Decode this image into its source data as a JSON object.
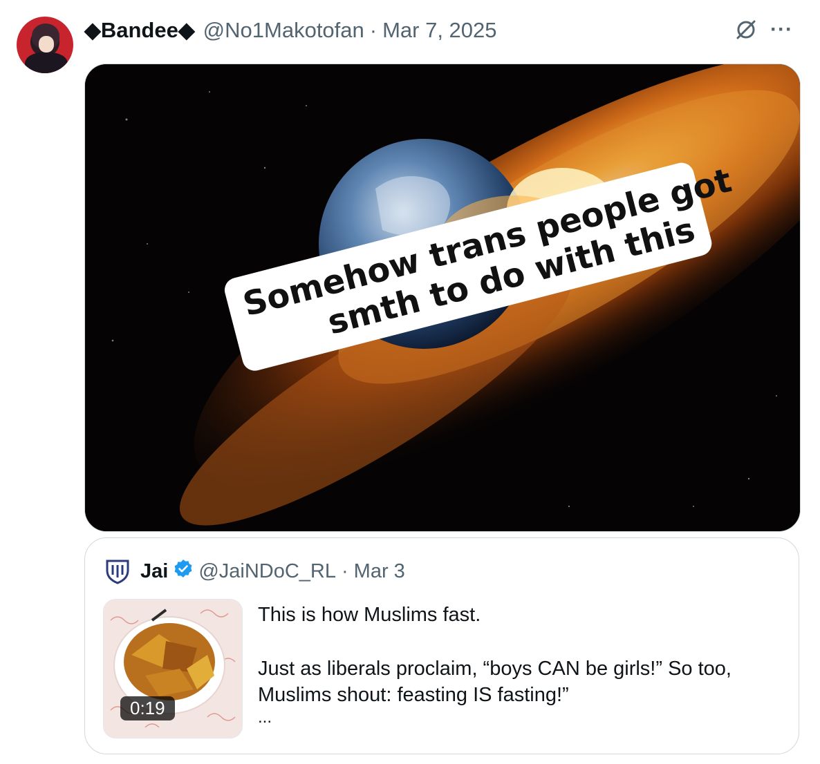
{
  "post": {
    "author_name": "◆Bandee◆",
    "author_handle": "@No1Makotofan",
    "separator": "·",
    "date": "Mar 7, 2025",
    "more_label": "···",
    "image_caption_line1": "Somehow trans people got",
    "image_caption_line2": "smth to do with this"
  },
  "quoted_post": {
    "author_name": "Jai",
    "author_handle": "@JaiNDoC_RL",
    "separator": "·",
    "date": "Mar 3",
    "video_duration": "0:19",
    "text_line1": "This is how Muslims fast.",
    "text_line2": "Just as liberals proclaim, “boys CAN be girls!” So too, Muslims shout: feasting IS fasting!”",
    "truncation": "..."
  },
  "colors": {
    "text_primary": "#0f1419",
    "text_secondary": "#536471",
    "border": "#cfd9de",
    "verified_blue": "#1d9bf0"
  }
}
